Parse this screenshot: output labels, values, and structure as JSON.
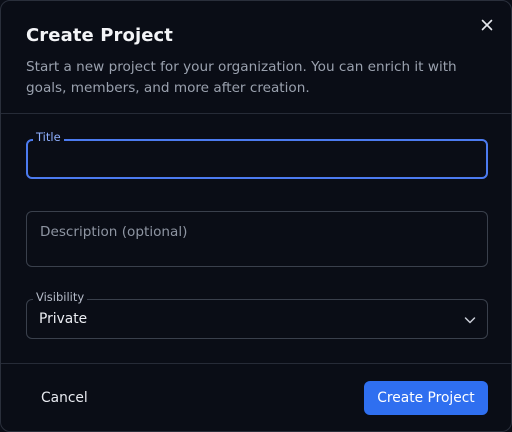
{
  "dialog": {
    "title": "Create Project",
    "subtitle": "Start a new project for your organization. You can enrich it with goals, members, and more after creation.",
    "close_icon": "close-icon"
  },
  "form": {
    "title_field": {
      "label": "Title",
      "value": ""
    },
    "description_field": {
      "placeholder": "Description (optional)",
      "value": ""
    },
    "visibility_field": {
      "label": "Visibility",
      "selected": "Private",
      "icon": "chevron-down-icon"
    }
  },
  "footer": {
    "cancel_label": "Cancel",
    "submit_label": "Create Project"
  },
  "colors": {
    "accent": "#2f6ff0",
    "focus_border": "#4c7bf0",
    "background": "#0a0d16"
  }
}
